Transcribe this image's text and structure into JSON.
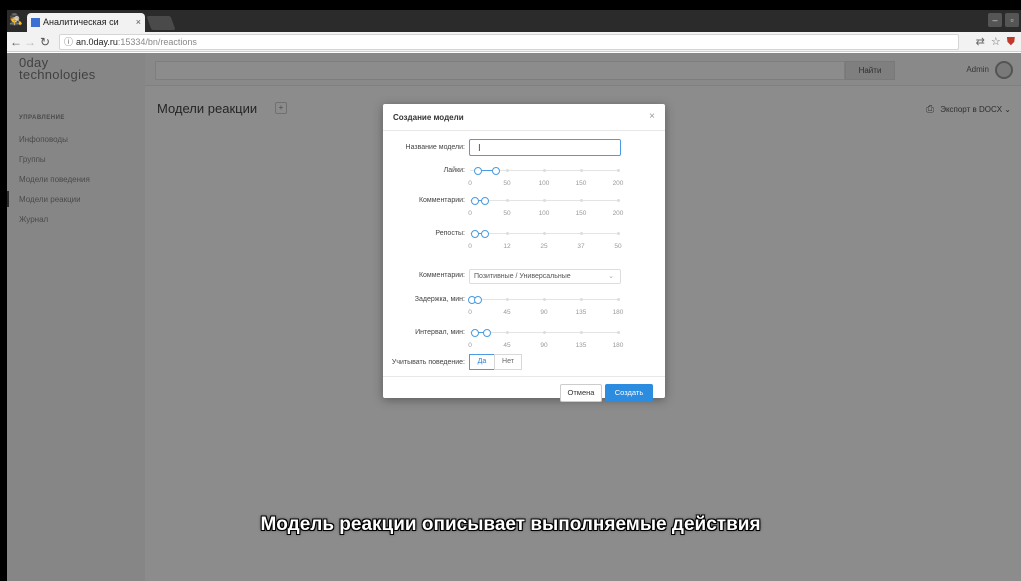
{
  "browser": {
    "tab_title": "Аналитическая си",
    "tab_close": "×",
    "url_host": "an.0day.ru",
    "url_rest": ":15334/bn/reactions",
    "url_info": "ⓘ"
  },
  "app": {
    "logo_line1": "0day",
    "logo_line2": "technologies",
    "nav_heading": "УПРАВЛЕНИЕ",
    "nav_items": [
      "Инфоповоды",
      "Группы",
      "Модели поведения",
      "Модели реакции",
      "Журнал"
    ],
    "find_button": "Найти",
    "user_name": "Admin",
    "page_title": "Модели реакции",
    "title_plus": "+",
    "export_label": "Экспорт в DOCX",
    "export_chevron": "⌄"
  },
  "modal": {
    "title": "Создание модели",
    "close": "×",
    "name_label": "Название модели:",
    "name_value": "",
    "likes_label": "Лайки:",
    "likes_ticks": [
      "0",
      "50",
      "100",
      "150",
      "200"
    ],
    "comments_count_label": "Комментарии:",
    "comments_ticks": [
      "0",
      "50",
      "100",
      "150",
      "200"
    ],
    "reposts_label": "Репосты:",
    "reposts_ticks": [
      "0",
      "12",
      "25",
      "37",
      "50"
    ],
    "comments_type_label": "Комментарии:",
    "comments_type_value": "Позитивные / Универсальные",
    "delay_label": "Задержка, мин:",
    "delay_ticks": [
      "0",
      "45",
      "90",
      "135",
      "180"
    ],
    "interval_label": "Интервал, мин:",
    "interval_ticks": [
      "0",
      "45",
      "90",
      "135",
      "180"
    ],
    "behavior_label": "Учитывать поведение:",
    "yes_label": "Да",
    "no_label": "Нет",
    "behavior_selected": "Да",
    "cancel_label": "Отмена",
    "create_label": "Создать"
  },
  "sliders": {
    "likes": [
      0.04,
      0.16
    ],
    "comments": [
      0.02,
      0.09
    ],
    "reposts": [
      0.02,
      0.09
    ],
    "delay": [
      0.0,
      0.04
    ],
    "interval": [
      0.02,
      0.1
    ]
  },
  "colors": {
    "accent": "#2b8ce0",
    "overlay": "rgba(0,0,0,0.45)"
  },
  "subtitle": "Модель реакции описывает выполняемые действия"
}
